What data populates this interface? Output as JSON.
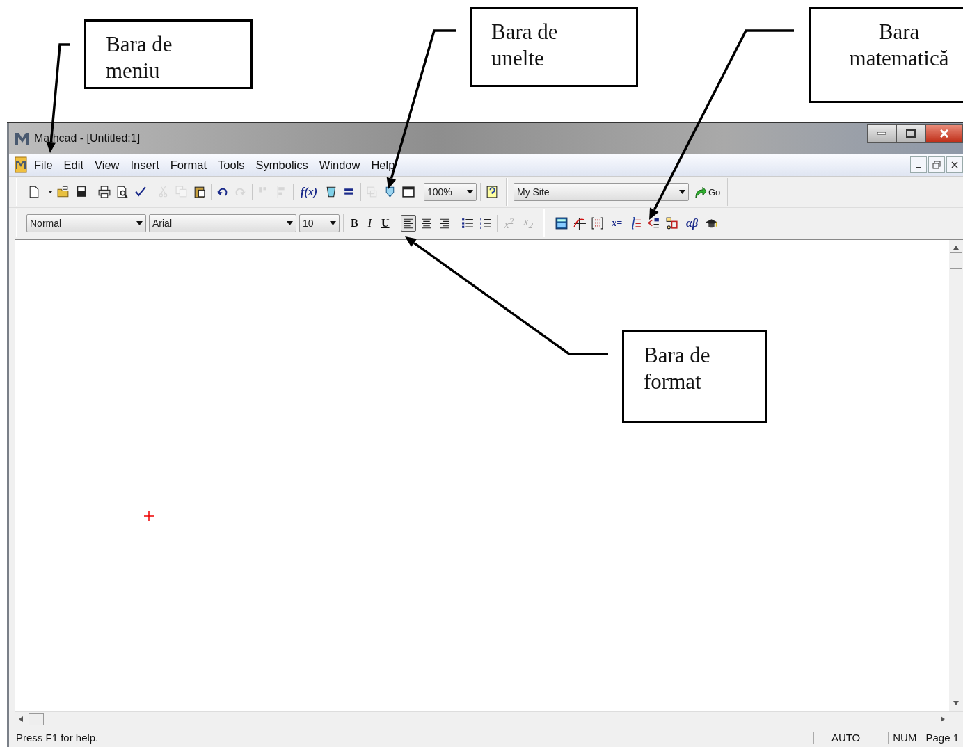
{
  "callouts": [
    {
      "lines": [
        "Bara de",
        "meniu"
      ]
    },
    {
      "lines": [
        "Bara de",
        "unelte"
      ]
    },
    {
      "lines": [
        "Bara",
        "matematică"
      ]
    },
    {
      "lines": [
        "Bara de",
        "format"
      ]
    }
  ],
  "window": {
    "title": "Mathcad - [Untitled:1]"
  },
  "menu": [
    "File",
    "Edit",
    "View",
    "Insert",
    "Format",
    "Tools",
    "Symbolics",
    "Window",
    "Help"
  ],
  "standard_toolbar": [
    [
      {
        "kind": "new",
        "disabled": false
      },
      {
        "kind": "menu-caret",
        "disabled": false
      },
      {
        "kind": "open",
        "disabled": false
      },
      {
        "kind": "save",
        "disabled": false
      }
    ],
    [
      {
        "kind": "print",
        "disabled": false
      },
      {
        "kind": "preview",
        "disabled": false
      },
      {
        "kind": "spell",
        "disabled": false
      }
    ],
    [
      {
        "kind": "cut",
        "disabled": true
      },
      {
        "kind": "copy",
        "disabled": true
      },
      {
        "kind": "paste",
        "disabled": false
      }
    ],
    [
      {
        "kind": "undo",
        "disabled": false
      },
      {
        "kind": "redo",
        "disabled": true
      }
    ],
    [
      {
        "kind": "align-top",
        "disabled": true
      },
      {
        "kind": "align-left-edges",
        "disabled": true
      }
    ],
    [
      {
        "kind": "function",
        "label": "f(x)",
        "disabled": false
      },
      {
        "kind": "unit",
        "disabled": false
      },
      {
        "kind": "calculate",
        "disabled": false
      }
    ],
    [
      {
        "kind": "component",
        "disabled": true
      },
      {
        "kind": "resource",
        "disabled": false
      },
      {
        "kind": "region",
        "disabled": false
      }
    ],
    [
      {
        "kind": "combo",
        "value": "100%",
        "disabled": false
      }
    ],
    [
      {
        "kind": "help",
        "disabled": false
      }
    ]
  ],
  "web_toolbar": {
    "address": "My Site",
    "go": "Go"
  },
  "format_toolbar": [
    [
      {
        "kind": "combo",
        "value": "Normal",
        "disabled": false
      },
      {
        "kind": "combo",
        "value": "Arial",
        "disabled": false
      },
      {
        "kind": "combo",
        "value": "10",
        "disabled": false
      }
    ],
    [
      {
        "kind": "bold",
        "label": "B",
        "disabled": false
      },
      {
        "kind": "italic",
        "label": "I",
        "disabled": false
      },
      {
        "kind": "underline",
        "label": "U",
        "disabled": false
      }
    ],
    [
      {
        "kind": "align-left",
        "selected": true,
        "disabled": false
      },
      {
        "kind": "align-center",
        "selected": false,
        "disabled": false
      },
      {
        "kind": "align-right",
        "selected": false,
        "disabled": false
      }
    ],
    [
      {
        "kind": "bullets",
        "disabled": false
      },
      {
        "kind": "numbering",
        "disabled": false
      }
    ],
    [
      {
        "kind": "superscript",
        "label": "x$^{2}$",
        "disabled": true
      },
      {
        "kind": "subscript",
        "label": "x$_{2}$",
        "disabled": true
      }
    ]
  ],
  "math_toolbar": [
    {
      "kind": "calculator",
      "disabled": false
    },
    {
      "kind": "graph",
      "disabled": false
    },
    {
      "kind": "matrix",
      "disabled": false
    },
    {
      "kind": "evaluation",
      "label": "x=",
      "disabled": false
    },
    {
      "kind": "calculus",
      "disabled": false
    },
    {
      "kind": "boolean",
      "disabled": false
    },
    {
      "kind": "programming",
      "disabled": false
    },
    {
      "kind": "greek",
      "label": "αβ",
      "disabled": false
    },
    {
      "kind": "symbolic",
      "disabled": false
    }
  ],
  "status_bar": [
    "Press F1 for help.",
    "AUTO",
    "NUM",
    "Page 1"
  ]
}
